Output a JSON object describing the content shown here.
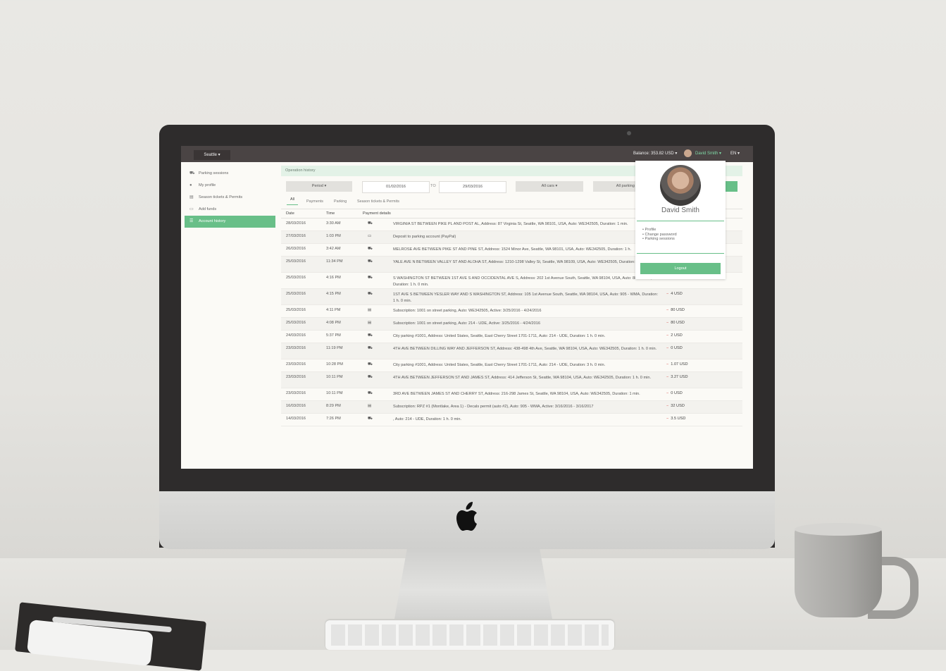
{
  "topbar": {
    "city": "Seattle ▾",
    "balance": "Balance: 353.82 USD ▾",
    "user": "David Smith ▾",
    "lang": "EN ▾"
  },
  "sidebar": {
    "items": [
      {
        "icon": "car-icon",
        "label": "Parking sessions"
      },
      {
        "icon": "user-icon",
        "label": "My profile"
      },
      {
        "icon": "document-icon",
        "label": "Season tickets & Permits"
      },
      {
        "icon": "wallet-icon",
        "label": "Add funds"
      },
      {
        "icon": "history-icon",
        "label": "Account history"
      }
    ]
  },
  "main": {
    "breadcrumb": "Operation history",
    "filters": {
      "period": "Period ▾",
      "date_from": "01/02/2016",
      "to_label": "TO",
      "date_to": "29/03/2016",
      "cars": "All cars ▾",
      "parking": "All parking ▾"
    },
    "tabs": [
      "All",
      "Payments",
      "Parking",
      "Season tickets & Permits"
    ],
    "table": {
      "headers": {
        "date": "Date",
        "time": "Time",
        "details": "Payment details"
      },
      "rows": [
        {
          "date": "28/03/2016",
          "time": "3:30 AM",
          "icon": "car-icon",
          "details": "VIRGINIA ST BETWEEN PIKE PL AND POST AL, Address: 87 Virginia St, Seattle, WA 98101, USA, Auto: WE342505, Duration: 1 min.",
          "amount": ""
        },
        {
          "date": "27/03/2016",
          "time": "1:03 PM",
          "icon": "card-icon",
          "details": "Deposit to parking account (PayPal)",
          "amount": ""
        },
        {
          "date": "26/03/2016",
          "time": "3:42 AM",
          "icon": "car-icon",
          "details": "MELROSE AVE BETWEEN PIKE ST AND PINE ST, Address: 1524 Minor Ave, Seattle, WA 98101, USA, Auto: WE342505, Duration: 1 h.",
          "amount": ""
        },
        {
          "date": "25/03/2016",
          "time": "11:34 PM",
          "icon": "car-icon",
          "details": "YALE AVE N BETWEEN VALLEY ST AND ALOHA ST, Address: 1210-1298 Valley St, Seattle, WA 98109, USA, Auto: WE342505, Duration: 1 h. 0 min.",
          "amount": ""
        },
        {
          "date": "25/03/2016",
          "time": "4:16 PM",
          "icon": "car-icon",
          "details": "S WASHINGTON ST BETWEEN 1ST AVE S AND OCCIDENTAL AVE S, Address: 202 1st Avenue South, Seattle, WA 98104, USA, Auto: 8807 - MZ, Duration: 1 h. 0 min.",
          "amount": "4 USD"
        },
        {
          "date": "25/03/2016",
          "time": "4:15 PM",
          "icon": "car-icon",
          "details": "1ST AVE S BETWEEN YESLER WAY AND S WASHINGTON ST, Address: 105 1st Avenue South, Seattle, WA 98104, USA, Auto: 905 - WMA, Duration: 1 h. 0 min.",
          "amount": "4 USD"
        },
        {
          "date": "25/03/2016",
          "time": "4:11 PM",
          "icon": "document-icon",
          "details": "Subscription: 1001 on street parking, Auto: WE342505, Active: 3/25/2016 - 4/24/2016",
          "amount": "80 USD"
        },
        {
          "date": "25/03/2016",
          "time": "4:08 PM",
          "icon": "document-icon",
          "details": "Subscription: 1001 on street parking, Auto: 214 - UDE, Active: 3/25/2016 - 4/24/2016",
          "amount": "80 USD"
        },
        {
          "date": "24/03/2016",
          "time": "5:37 PM",
          "icon": "car-icon",
          "details": "City parking #1001, Address: United States, Seattle, East Cherry Street 1701-1711, Auto: 214 - UDE, Duration: 1 h. 0 min.",
          "amount": "2 USD"
        },
        {
          "date": "23/03/2016",
          "time": "11:19 PM",
          "icon": "car-icon",
          "details": "4TH AVE BETWEEN DILLING WAY AND JEFFERSON ST, Address: 438-498 4th Ave, Seattle, WA 98104, USA, Auto: WE342505, Duration: 1 h. 0 min.",
          "amount": "0 USD"
        },
        {
          "date": "23/03/2016",
          "time": "10:28 PM",
          "icon": "car-icon",
          "details": "City parking #1001, Address: United States, Seattle, East Cherry Street 1701-1711, Auto: 214 - UDE, Duration: 3 h. 0 min.",
          "amount": "1.07 USD"
        },
        {
          "date": "23/03/2016",
          "time": "10:11 PM",
          "icon": "car-icon",
          "details": "4TH AVE BETWEEN JEFFERSON ST AND JAMES ST, Address: 414 Jefferson St, Seattle, WA 98104, USA, Auto: WE342505, Duration: 1 h. 0 min.",
          "amount": "3.27 USD"
        },
        {
          "date": "23/03/2016",
          "time": "10:11 PM",
          "icon": "car-icon",
          "details": "3RD AVE BETWEEN JAMES ST AND CHERRY ST, Address: 216-298 James St, Seattle, WA 98104, USA, Auto: WE342505, Duration: 1 min.",
          "amount": "0 USD"
        },
        {
          "date": "16/03/2016",
          "time": "8:29 PM",
          "icon": "document-icon",
          "details": "Subscription: RPZ #1 (Montlake, Area 1) - Decals permit (auto #2), Auto: 905 - WMA, Active: 3/16/2016 - 3/16/2017",
          "amount": "32 USD"
        },
        {
          "date": "14/03/2016",
          "time": "7:26 PM",
          "icon": "car-icon",
          "details": ", Auto: 214 - UDE, Duration: 1 h. 0 min.",
          "amount": "3.5 USD"
        }
      ]
    }
  },
  "dropdown": {
    "name": "David Smith",
    "links": [
      "Profile",
      "Change password",
      "Parking sessions"
    ],
    "logout": "Logout"
  },
  "colors": {
    "accent": "#68bf88",
    "topbar": "#4a4444",
    "negative": "#d9534f"
  }
}
